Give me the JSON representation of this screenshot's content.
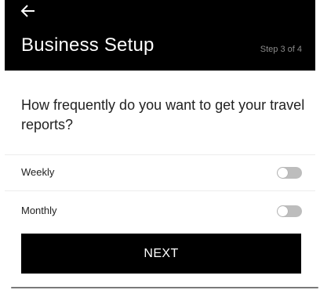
{
  "header": {
    "back_icon": "arrow-left-icon",
    "title": "Business Setup",
    "step_text": "Step 3 of 4"
  },
  "question": "How frequently do you want to get your travel reports?",
  "options": [
    {
      "label": "Weekly",
      "toggle_on": false
    },
    {
      "label": "Monthly",
      "toggle_on": false
    }
  ],
  "next_button": {
    "label": "NEXT"
  },
  "colors": {
    "header_background": "#000000",
    "header_text": "#ffffff",
    "step_text": "#8a8a8a",
    "toggle_off": "#bdbdbd",
    "button_background": "#000000"
  }
}
